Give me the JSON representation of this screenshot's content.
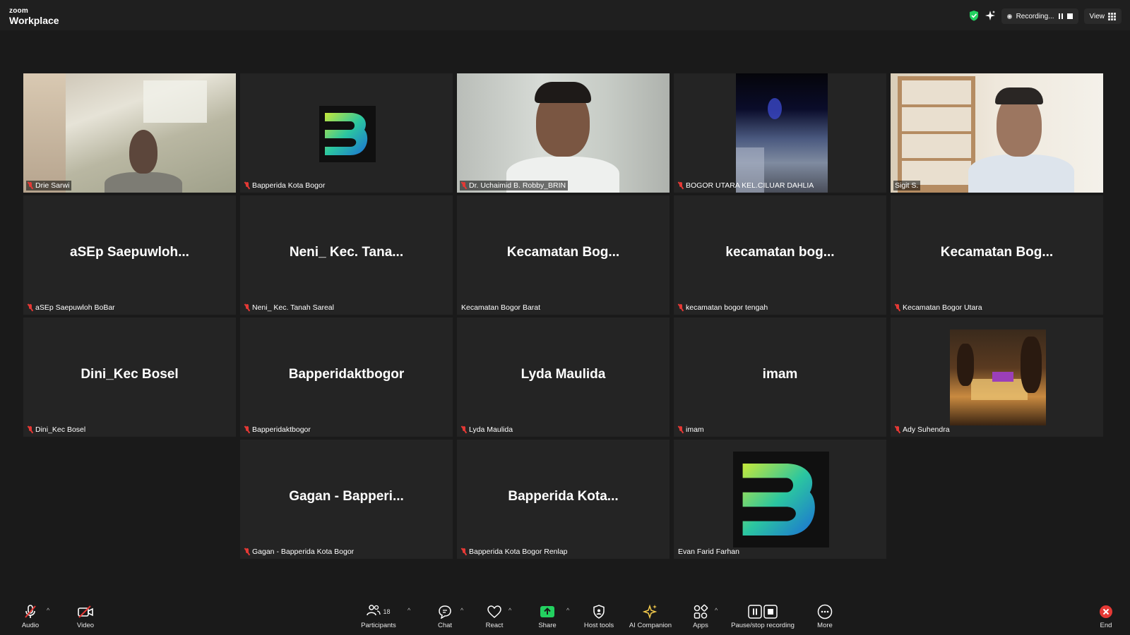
{
  "app": {
    "brand_small": "zoom",
    "brand_title": "Workplace"
  },
  "topbar": {
    "recording_label": "Recording...",
    "view_label": "View"
  },
  "participants": [
    {
      "name": "Drie Sarwi",
      "display": "",
      "muted": true,
      "video": true
    },
    {
      "name": "Bapperida Kota Bogor",
      "display": "",
      "muted": true,
      "video": false,
      "logo": true
    },
    {
      "name": "Dr. Uchaimid B. Robby_BRIN",
      "display": "",
      "muted": true,
      "video": true
    },
    {
      "name": "BOGOR UTARA KEL.CILUAR DAHLIA",
      "display": "",
      "muted": true,
      "video": true
    },
    {
      "name": "Sigit S.",
      "display": "",
      "muted": false,
      "video": true,
      "active_speaker": true
    },
    {
      "name": "aSEp Saepuwloh BoBar",
      "display": "aSEp  Saepuwloh...",
      "muted": true
    },
    {
      "name": "Neni_ Kec. Tanah Sareal",
      "display": "Neni_  Kec.  Tana...",
      "muted": true
    },
    {
      "name": "Kecamatan Bogor Barat",
      "display": "Kecamatan  Bog...",
      "muted": false
    },
    {
      "name": "kecamatan bogor tengah",
      "display": "kecamatan  bog...",
      "muted": true
    },
    {
      "name": "Kecamatan Bogor Utara",
      "display": "Kecamatan  Bog...",
      "muted": true
    },
    {
      "name": "Dini_Kec Bosel",
      "display": "Dini_Kec Bosel",
      "muted": true
    },
    {
      "name": "Bapperidaktbogor",
      "display": "Bapperidaktbogor",
      "muted": true
    },
    {
      "name": "Lyda Maulida",
      "display": "Lyda Maulida",
      "muted": true
    },
    {
      "name": "imam",
      "display": "imam",
      "muted": true
    },
    {
      "name": "Ady Suhendra",
      "display": "",
      "muted": true,
      "photo": true
    },
    {
      "name": "Gagan - Bapperida Kota Bogor",
      "display": "Gagan  -  Bapperi...",
      "muted": true
    },
    {
      "name": "Bapperida Kota Bogor Renlap",
      "display": "Bapperida  Kota...",
      "muted": true
    },
    {
      "name": "Evan Farid Farhan",
      "display": "",
      "muted": false,
      "logo": true
    }
  ],
  "toolbar": {
    "audio": "Audio",
    "video": "Video",
    "participants": "Participants",
    "participants_count": "18",
    "chat": "Chat",
    "react": "React",
    "share": "Share",
    "host_tools": "Host tools",
    "ai_companion": "AI Companion",
    "apps": "Apps",
    "pause_recording": "Pause/stop recording",
    "more": "More",
    "end": "End"
  },
  "colors": {
    "active_speaker": "#23d160",
    "share": "#23d160",
    "end": "#e53935",
    "muted": "#e53935"
  }
}
